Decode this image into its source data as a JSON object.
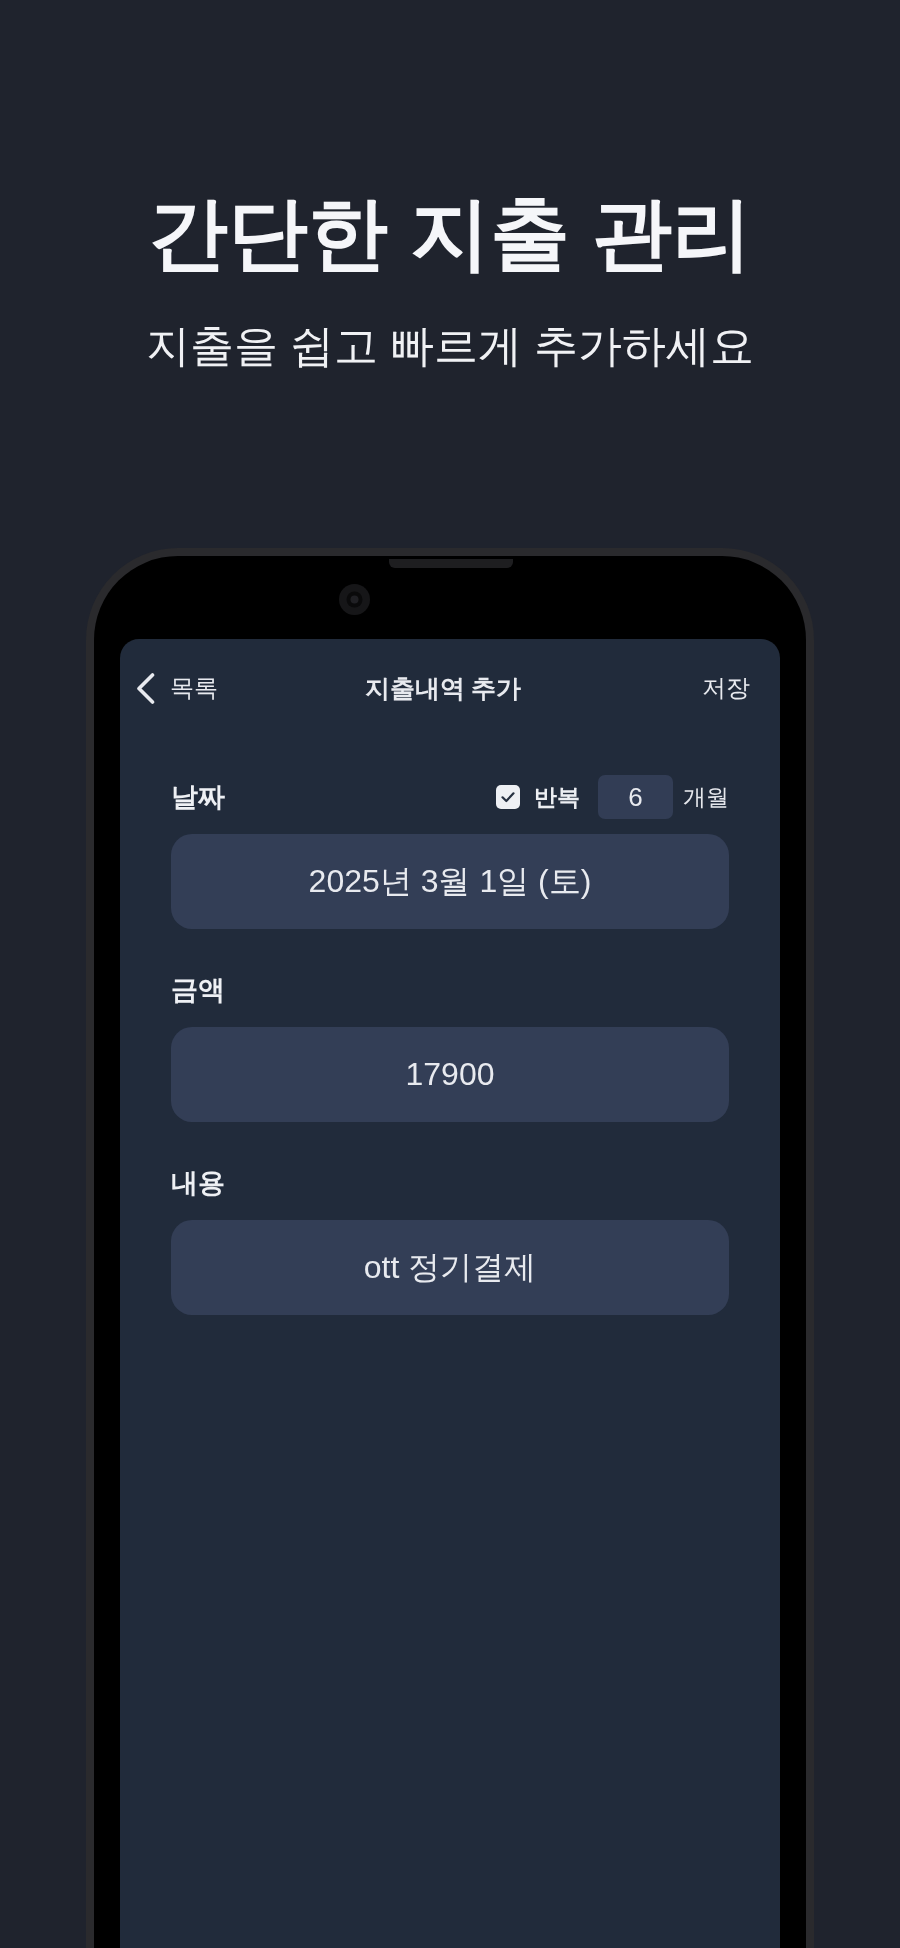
{
  "promo": {
    "title": "간단한 지출 관리",
    "subtitle": "지출을 쉽고 빠르게 추가하세요"
  },
  "nav": {
    "back": "목록",
    "title": "지출내역 추가",
    "action": "저장"
  },
  "form": {
    "fields": [
      {
        "label": "날짜",
        "value": "2025년 3월 1일 (토)",
        "repeat": {
          "label": "반복",
          "checked": true,
          "count": "6",
          "unit": "개월"
        }
      },
      {
        "label": "금액",
        "value": "17900"
      },
      {
        "label": "내용",
        "value": "ott 정기결제"
      }
    ]
  }
}
